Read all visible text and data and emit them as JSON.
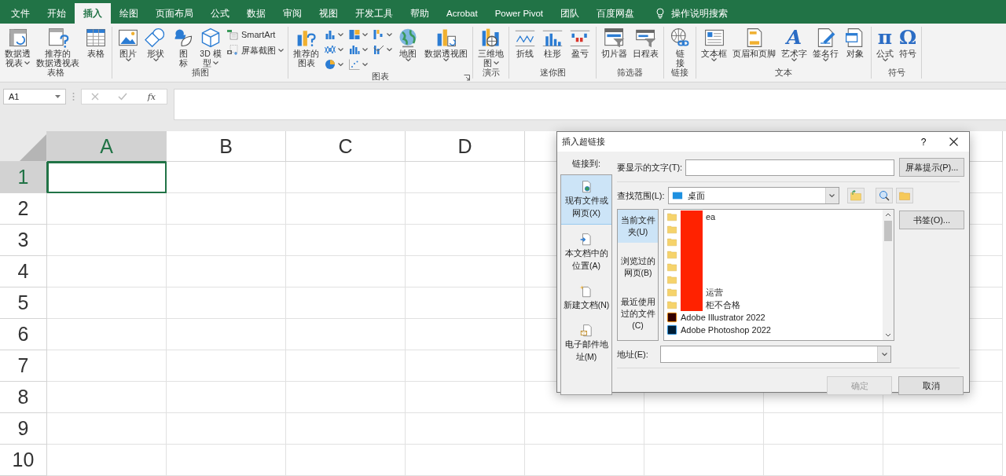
{
  "title_bar": {
    "tabs": [
      {
        "label": "文件",
        "selected": false
      },
      {
        "label": "开始",
        "selected": false
      },
      {
        "label": "插入",
        "selected": true
      },
      {
        "label": "绘图",
        "selected": false
      },
      {
        "label": "页面布局",
        "selected": false
      },
      {
        "label": "公式",
        "selected": false
      },
      {
        "label": "数据",
        "selected": false
      },
      {
        "label": "审阅",
        "selected": false
      },
      {
        "label": "视图",
        "selected": false
      },
      {
        "label": "开发工具",
        "selected": false
      },
      {
        "label": "帮助",
        "selected": false
      },
      {
        "label": "Acrobat",
        "selected": false
      },
      {
        "label": "Power Pivot",
        "selected": false
      },
      {
        "label": "团队",
        "selected": false
      },
      {
        "label": "百度网盘",
        "selected": false
      }
    ],
    "tell_me": "操作说明搜索"
  },
  "ribbon": {
    "groups": [
      {
        "label": "表格",
        "launcher": false,
        "items": [
          {
            "kind": "big",
            "lines": [
              "数据透",
              "视表"
            ],
            "dropdown": true
          },
          {
            "kind": "big",
            "lines": [
              "推荐的",
              "数据透视表"
            ],
            "dropdown": false
          },
          {
            "kind": "big",
            "lines": [
              "表格"
            ],
            "dropdown": false
          }
        ]
      },
      {
        "label": "插图",
        "launcher": false,
        "items": [
          {
            "kind": "big",
            "lines": [
              "图片"
            ],
            "dropdown": true
          },
          {
            "kind": "big",
            "lines": [
              "形状"
            ],
            "dropdown": true
          },
          {
            "kind": "big",
            "lines": [
              "图",
              "标"
            ],
            "dropdown": false
          },
          {
            "kind": "big",
            "lines": [
              "3D 模",
              "型"
            ],
            "dropdown": true
          },
          {
            "kind": "stack",
            "entries": [
              {
                "label": "SmartArt",
                "dropdown": false
              },
              {
                "label": "屏幕截图",
                "dropdown": true
              }
            ]
          }
        ]
      },
      {
        "label": "图表",
        "launcher": true,
        "items": [
          {
            "kind": "big",
            "lines": [
              "推荐的",
              "图表"
            ],
            "dropdown": false
          },
          {
            "kind": "icon_grid",
            "charts": [
              {
                "kind": "column"
              },
              {
                "kind": "line"
              },
              {
                "kind": "pie"
              },
              {
                "kind": "hierarchy"
              },
              {
                "kind": "histogram"
              },
              {
                "kind": "scatter"
              },
              {
                "kind": "waterfall"
              },
              {
                "kind": "combo"
              }
            ]
          },
          {
            "kind": "big",
            "lines": [
              "地图"
            ],
            "dropdown": true
          },
          {
            "kind": "big",
            "lines": [
              "数据透视图"
            ],
            "dropdown": true
          }
        ]
      },
      {
        "label": "演示",
        "launcher": false,
        "items": [
          {
            "kind": "big",
            "lines": [
              "三维地",
              "图"
            ],
            "dropdown": true
          }
        ]
      },
      {
        "label": "迷你图",
        "launcher": false,
        "items": [
          {
            "kind": "big",
            "lines": [
              "折线"
            ],
            "dropdown": false
          },
          {
            "kind": "big",
            "lines": [
              "柱形"
            ],
            "dropdown": false
          },
          {
            "kind": "big",
            "lines": [
              "盈亏"
            ],
            "dropdown": false
          }
        ]
      },
      {
        "label": "筛选器",
        "launcher": false,
        "items": [
          {
            "kind": "big",
            "lines": [
              "切片器"
            ],
            "dropdown": false
          },
          {
            "kind": "big",
            "lines": [
              "日程表"
            ],
            "dropdown": false
          }
        ]
      },
      {
        "label": "链接",
        "launcher": false,
        "items": [
          {
            "kind": "big",
            "lines": [
              "链",
              "接"
            ],
            "dropdown": false
          }
        ]
      },
      {
        "label": "文本",
        "launcher": false,
        "items": [
          {
            "kind": "big",
            "lines": [
              "文本框"
            ],
            "dropdown": true
          },
          {
            "kind": "big",
            "lines": [
              "页眉和页脚"
            ],
            "dropdown": false
          },
          {
            "kind": "big",
            "glyph": "A",
            "lines": [
              "艺术字"
            ],
            "dropdown": true
          },
          {
            "kind": "big",
            "lines": [
              "签名行"
            ],
            "dropdown": true
          },
          {
            "kind": "big",
            "lines": [
              "对象"
            ],
            "dropdown": false
          }
        ]
      },
      {
        "label": "符号",
        "launcher": false,
        "items": [
          {
            "kind": "big",
            "glyph": "π",
            "lines": [
              "公式"
            ],
            "dropdown": true
          },
          {
            "kind": "big",
            "glyph": "Ω",
            "lines": [
              "符号"
            ],
            "dropdown": false
          }
        ]
      }
    ]
  },
  "formula_bar": {
    "name_box": "A1",
    "function_label": "fx"
  },
  "grid": {
    "columns": [
      {
        "label": "A",
        "selected": true
      },
      {
        "label": "B",
        "selected": false
      },
      {
        "label": "C",
        "selected": false
      },
      {
        "label": "D",
        "selected": false
      }
    ],
    "rows": [
      {
        "label": "1",
        "selected": true
      },
      {
        "label": "2",
        "selected": false
      },
      {
        "label": "3",
        "selected": false
      },
      {
        "label": "4",
        "selected": false
      },
      {
        "label": "5",
        "selected": false
      },
      {
        "label": "6",
        "selected": false
      },
      {
        "label": "7",
        "selected": false
      },
      {
        "label": "8",
        "selected": false
      },
      {
        "label": "9",
        "selected": false
      },
      {
        "label": "10",
        "selected": false
      }
    ]
  },
  "dialog": {
    "title": "插入超链接",
    "help": "?",
    "link_to_label": "链接到:",
    "link_targets": [
      {
        "label": "现有文件或网页(X)",
        "selected": true
      },
      {
        "label": "本文档中的位置(A)",
        "selected": false
      },
      {
        "label": "新建文档(N)",
        "selected": false
      },
      {
        "label": "电子邮件地址(M)",
        "selected": false
      }
    ],
    "display_text": {
      "label": "要显示的文字(T):"
    },
    "screen_tip_button": "屏幕提示(P)...",
    "look_in": {
      "label": "查找范围(L):",
      "value": "桌面"
    },
    "browse_places": [
      {
        "label": "当前文件夹(U)",
        "selected": true
      },
      {
        "label": "浏览过的网页(B)",
        "selected": false
      },
      {
        "label": "最近使用过的文件(C)",
        "selected": false
      }
    ],
    "files": [
      {
        "kind": "folder",
        "name": "ea",
        "redacted": true
      },
      {
        "kind": "folder",
        "redacted": true
      },
      {
        "kind": "folder",
        "redacted": true
      },
      {
        "kind": "folder",
        "redacted": true
      },
      {
        "kind": "folder",
        "redacted": true
      },
      {
        "kind": "folder",
        "redacted": true
      },
      {
        "kind": "folder",
        "name": "运营",
        "redacted": true
      },
      {
        "kind": "folder",
        "name": "柜不合格",
        "redacted": true
      },
      {
        "kind": "illustrator",
        "name": "Adobe Illustrator 2022",
        "redacted": false
      },
      {
        "kind": "photoshop",
        "name": "Adobe Photoshop 2022",
        "redacted": false
      }
    ],
    "bookmark_button": "书签(O)...",
    "address": {
      "label": "地址(E):"
    },
    "buttons": [
      {
        "label": "确定",
        "disabled": true
      },
      {
        "label": "取消",
        "disabled": false
      }
    ]
  }
}
